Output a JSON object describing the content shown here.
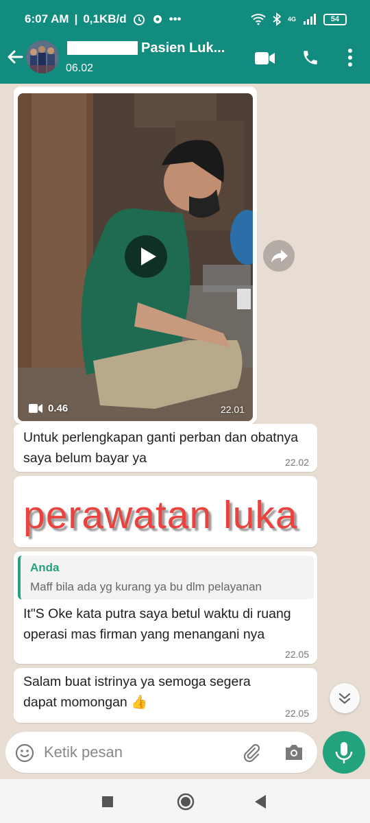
{
  "status_bar": {
    "time": "6:07 AM",
    "speed": "0,1KB/d",
    "network": "4G",
    "battery": "54"
  },
  "header": {
    "contact_name": "Pasien Luk...",
    "subtitle": "06.02"
  },
  "messages": [
    {
      "type": "video",
      "duration": "0.46",
      "time": "22.01"
    },
    {
      "type": "text",
      "text": "Untuk perlengkapan ganti perban dan obatnya saya belum bayar ya",
      "time": "22.02"
    },
    {
      "type": "image-text",
      "text": "perawatan luka"
    },
    {
      "type": "reply",
      "quote_author": "Anda",
      "quote_text": "Maff bila ada yg kurang ya bu dlm pelayanan",
      "text": "It\"S Oke kata putra saya betul waktu di ruang operasi mas firman yang menangani nya",
      "time": "22.05"
    },
    {
      "type": "text",
      "text": "Salam buat istrinya ya semoga segera dapat momongan 👍",
      "time": "22.05"
    }
  ],
  "input": {
    "placeholder": "Ketik pesan"
  },
  "colors": {
    "brand": "#128c7e",
    "accent": "#23a37d",
    "chat_bg": "#e7ddd3"
  },
  "icons": [
    "back-arrow-icon",
    "video-call-icon",
    "phone-icon",
    "more-vert-icon",
    "play-icon",
    "video-cam-icon",
    "forward-icon",
    "chevron-down-double-icon",
    "emoji-icon",
    "attach-icon",
    "camera-icon",
    "mic-icon"
  ]
}
